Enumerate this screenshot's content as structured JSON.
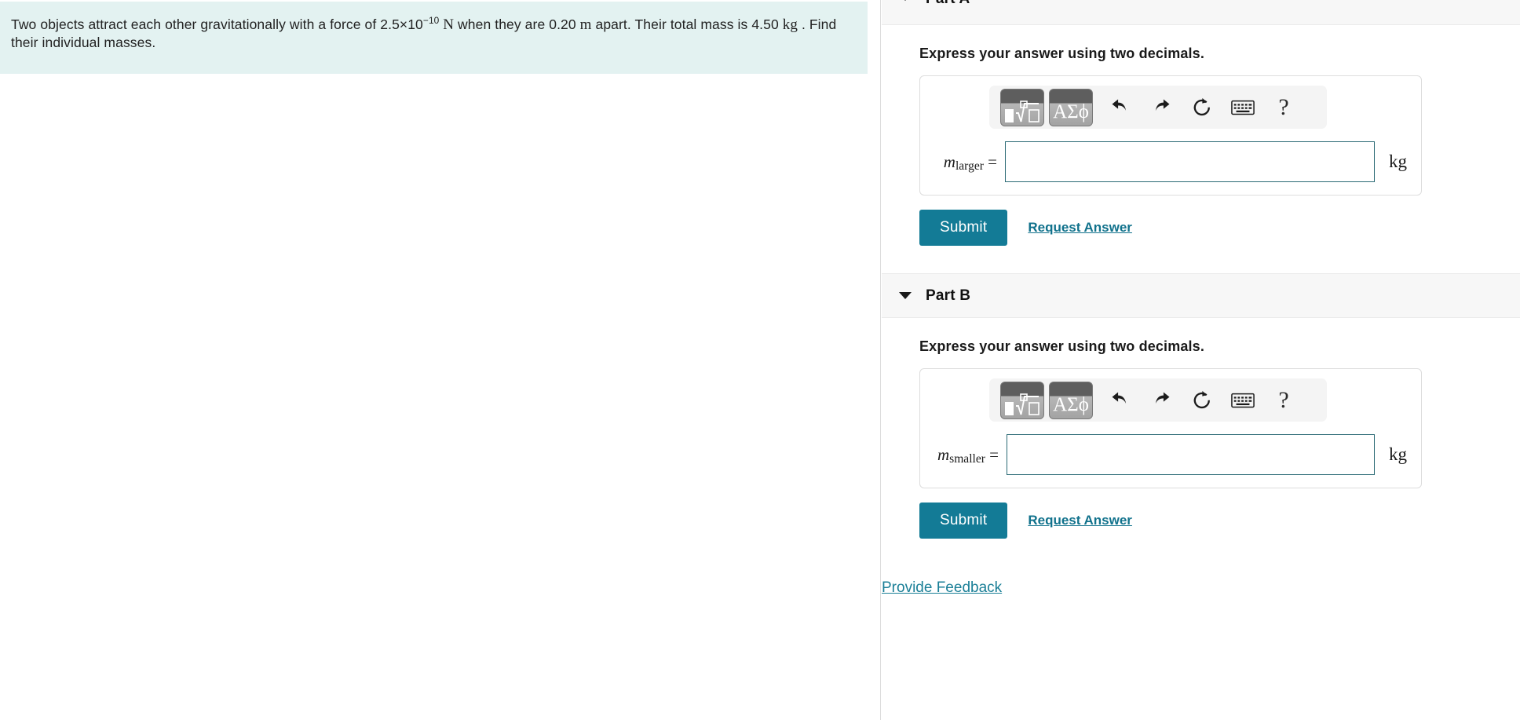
{
  "problem": {
    "text_part1": "Two objects attract each other gravitationally with a force of 2.5×10",
    "exponent": "−10",
    "unit_force": "N",
    "text_part2": " when they are 0.20 ",
    "unit_distance": "m",
    "text_part3": " apart. Their total mass is 4.50 ",
    "unit_mass": "kg",
    "text_part4": " . Find their individual masses."
  },
  "parts": [
    {
      "id": "part-a",
      "title": "Part A",
      "instruction": "Express your answer using two decimals.",
      "variable_base": "m",
      "variable_sub": "larger",
      "equals": "=",
      "input_value": "",
      "input_placeholder": "",
      "unit": "kg",
      "submit_label": "Submit",
      "request_label": "Request Answer"
    },
    {
      "id": "part-b",
      "title": "Part B",
      "instruction": "Express your answer using two decimals.",
      "variable_base": "m",
      "variable_sub": "smaller",
      "equals": "=",
      "input_value": "",
      "input_placeholder": "",
      "unit": "kg",
      "submit_label": "Submit",
      "request_label": "Request Answer"
    }
  ],
  "toolbar": {
    "template_button_label": "math-template",
    "greek_button_label": "ΑΣϕ",
    "undo_label": "undo",
    "redo_label": "redo",
    "reset_label": "reset",
    "keyboard_label": "keyboard",
    "help_label": "?"
  },
  "footer": {
    "feedback_label": "Provide Feedback"
  },
  "colors": {
    "problem_background": "#e3f2f1",
    "submit_background": "#137b96",
    "link": "#11728c",
    "input_border": "#2b6a75",
    "part_header_background": "#f7f7f7"
  }
}
